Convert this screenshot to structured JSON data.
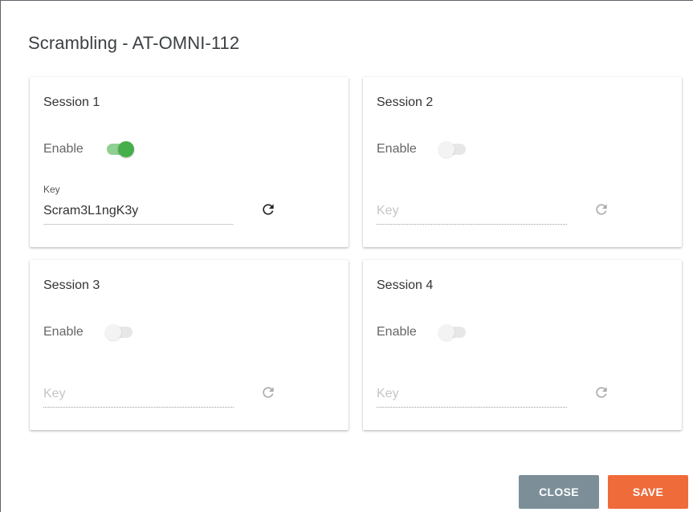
{
  "dialog": {
    "title": "Scrambling - AT-OMNI-112"
  },
  "sessions": [
    {
      "title": "Session 1",
      "enable_label": "Enable",
      "enabled": true,
      "key_label": "Key",
      "key_value": "Scram3L1ngK3y",
      "key_placeholder": "Key"
    },
    {
      "title": "Session 2",
      "enable_label": "Enable",
      "enabled": false,
      "key_label": "",
      "key_value": "",
      "key_placeholder": "Key"
    },
    {
      "title": "Session 3",
      "enable_label": "Enable",
      "enabled": false,
      "key_label": "",
      "key_value": "",
      "key_placeholder": "Key"
    },
    {
      "title": "Session 4",
      "enable_label": "Enable",
      "enabled": false,
      "key_label": "",
      "key_value": "",
      "key_placeholder": "Key"
    }
  ],
  "actions": {
    "close_label": "CLOSE",
    "save_label": "SAVE"
  },
  "colors": {
    "toggle_on_thumb": "#46ae4a",
    "toggle_on_track": "#8fcf92",
    "close_button": "#7c8f99",
    "save_button": "#ef6b3a"
  },
  "icons": {
    "refresh": "refresh-icon"
  }
}
